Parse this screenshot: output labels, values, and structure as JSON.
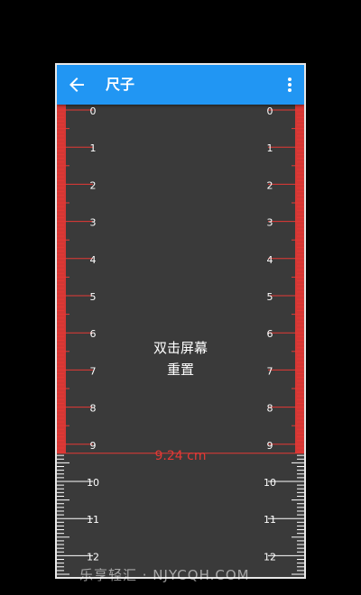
{
  "app": {
    "title": "尺子"
  },
  "ruler": {
    "unit": "cm",
    "tick_labels": [
      "0",
      "1",
      "2",
      "3",
      "4",
      "5",
      "6",
      "7",
      "8",
      "9",
      "10",
      "11",
      "12"
    ],
    "measured_value": 9.24,
    "measurement_text": "9.24 cm",
    "colors": {
      "background": "#3a3a3a",
      "ticks": "#ffffff",
      "highlight": "#e53935",
      "appbar": "#2196f3"
    }
  },
  "hint": {
    "line1": "双击屏幕",
    "line2": "重置"
  },
  "watermark": {
    "text": "乐享轻汇 · NJYCQH.COM"
  },
  "icons": {
    "back": "arrow-back-icon",
    "menu": "more-vert-icon"
  }
}
